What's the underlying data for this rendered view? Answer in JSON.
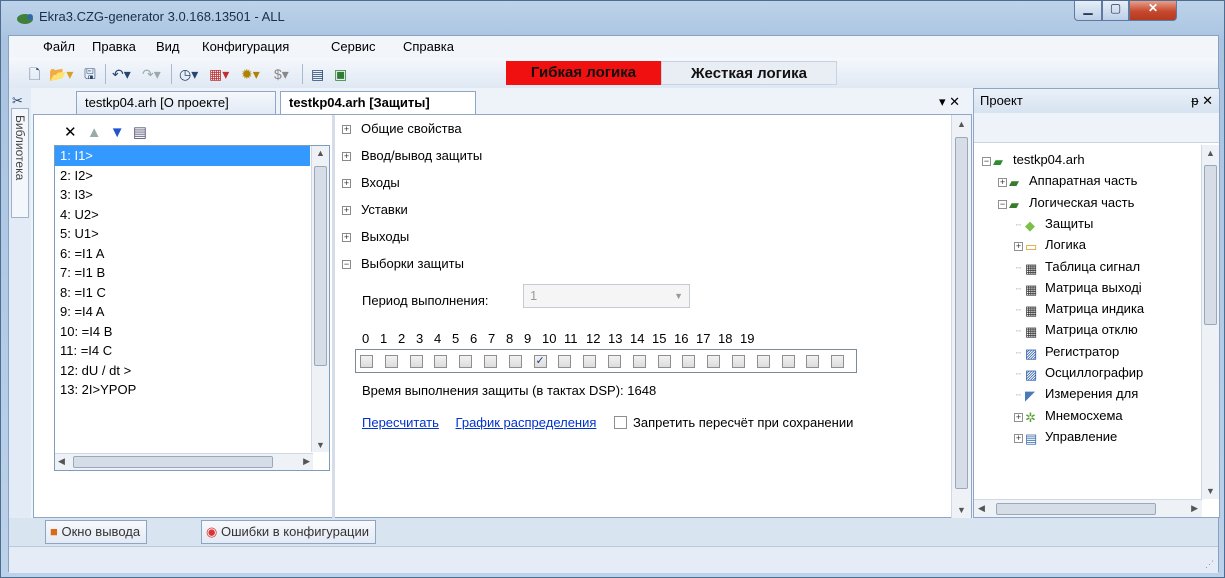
{
  "window": {
    "title": "Ekra3.CZG-generator 3.0.168.13501 - ALL"
  },
  "menu": [
    "Файл",
    "Правка",
    "Вид",
    "Конфигурация",
    "Сервис",
    "Справка"
  ],
  "toolbar": {
    "flex_logic": "Гибкая логика",
    "hard_logic": "Жесткая логика"
  },
  "library": {
    "label": "Библиотека"
  },
  "tabs": [
    {
      "label": "testkp04.arh [О проекте]"
    },
    {
      "label": "testkp04.arh [Защиты]"
    }
  ],
  "protections": [
    "1: I1>",
    "2: I2>",
    "3: I3>",
    "4: U2>",
    "5: U1>",
    "6: =I1 A",
    "7: =I1 B",
    "8: =I1 C",
    "9: =I4 A",
    "10: =I4 B",
    "11: =I4 C",
    "12: dU / dt >",
    "13: 2I>YPOP"
  ],
  "selected_protection_index": 0,
  "categories": [
    {
      "label": "Общие свойства",
      "expanded": false
    },
    {
      "label": "Ввод/вывод защиты",
      "expanded": false
    },
    {
      "label": "Входы",
      "expanded": false
    },
    {
      "label": "Уставки",
      "expanded": false
    },
    {
      "label": "Выходы",
      "expanded": false
    },
    {
      "label": "Выборки защиты",
      "expanded": true
    }
  ],
  "samples": {
    "period_label": "Период выполнения:",
    "period_value": "1",
    "numbers": [
      "0",
      "1",
      "2",
      "3",
      "4",
      "5",
      "6",
      "7",
      "8",
      "9",
      "10",
      "11",
      "12",
      "13",
      "14",
      "15",
      "16",
      "17",
      "18",
      "19"
    ],
    "checked_index": 7,
    "exec_time": "Время выполнения защиты (в тактах DSP): 1648",
    "recalc_link": "Пересчитать",
    "schedule_link": "График распределения",
    "prohibit_label": "Запретить пересчёт при сохранении"
  },
  "project": {
    "title": "Проект",
    "tree": [
      {
        "label": "testkp04.arh",
        "level": 0,
        "box": "−",
        "icon": "project-icon"
      },
      {
        "label": "Аппаратная часть",
        "level": 1,
        "box": "+",
        "icon": "folder-icon"
      },
      {
        "label": "Логическая часть",
        "level": 1,
        "box": "−",
        "icon": "folder-icon"
      },
      {
        "label": "Защиты",
        "level": 2,
        "box": "",
        "icon": "shield-icon"
      },
      {
        "label": "Логика",
        "level": 2,
        "box": "+",
        "icon": "logic-icon"
      },
      {
        "label": "Таблица сигнал",
        "level": 2,
        "box": "",
        "icon": "matrix-icon"
      },
      {
        "label": "Матрица выході",
        "level": 2,
        "box": "",
        "icon": "matrix-icon"
      },
      {
        "label": "Матрица индика",
        "level": 2,
        "box": "",
        "icon": "matrix-icon"
      },
      {
        "label": "Матрица отклю",
        "level": 2,
        "box": "",
        "icon": "matrix-icon"
      },
      {
        "label": "Регистратор",
        "level": 2,
        "box": "",
        "icon": "recorder-icon"
      },
      {
        "label": "Осциллографир",
        "level": 2,
        "box": "",
        "icon": "recorder-icon"
      },
      {
        "label": "Измерения для",
        "level": 2,
        "box": "",
        "icon": "measure-icon"
      },
      {
        "label": "Мнемосхема",
        "level": 2,
        "box": "+",
        "icon": "mnemo-icon"
      },
      {
        "label": "Управление",
        "level": 2,
        "box": "+",
        "icon": "control-icon"
      }
    ]
  },
  "bottom_tabs": [
    {
      "label": "Окно вывода"
    },
    {
      "label": "Ошибки в конфигурации"
    }
  ],
  "colors": {
    "flex_logic_bg": "#f01010",
    "selection": "#3399ff",
    "link": "#0033cc"
  }
}
